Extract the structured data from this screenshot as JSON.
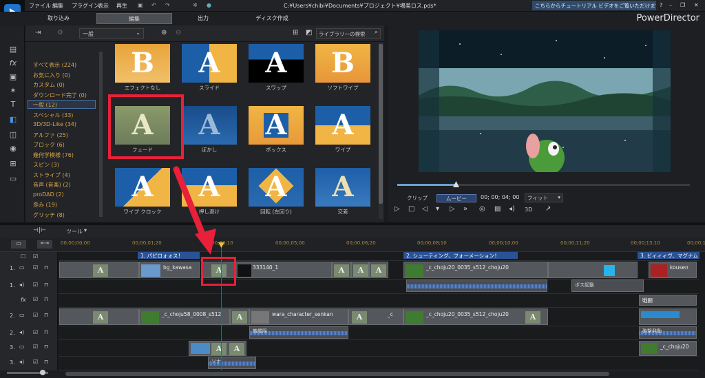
{
  "menu": [
    "ファイル",
    "編集",
    "プラグイン",
    "表示",
    "再生"
  ],
  "window_title": "C:¥Users¥chibi¥Documents¥プロジェクト¥場美ロス.pds*",
  "hint": "こちらからチュートリアル ビデオをご覧いただけます。",
  "app_name": "PowerDirector",
  "top_tabs": [
    "取り込み",
    "編集",
    "出力",
    "ディスク作成"
  ],
  "library": {
    "dropdown": "一般",
    "search_placeholder": "ライブラリーの検索",
    "categories": [
      "すべて表示 (224)",
      "お気に入り (0)",
      "カスタム (0)",
      "ダウンロード完了 (0)",
      "一般 (12)",
      "スペシャル (33)",
      "3D/3D-Like (34)",
      "アルファ (25)",
      "ブロック (6)",
      "幾何学模様 (76)",
      "スピン (3)",
      "ストライプ (4)",
      "音声 (音楽) (2)",
      "proDAD (2)",
      "歪み (19)",
      "グリッチ (8)"
    ],
    "selected_category": "一般 (12)",
    "transitions": [
      "エフェクトなし",
      "スライド",
      "スワップ",
      "ソフトワイプ",
      "フェード",
      "ぼかし",
      "ボックス",
      "ワイプ",
      "ワイプ クロック",
      "押し退け",
      "回転 (左回り)",
      "交差"
    ]
  },
  "preview": {
    "mode_clip": "クリップ",
    "mode_movie": "ムービー",
    "timecode": "00; 00; 04; 00",
    "fit": "フィット",
    "3d": "3D"
  },
  "timeline": {
    "tool_label": "ツール",
    "ruler": [
      "00;00;00;00",
      "00;00;01;20",
      "00;00;03;10",
      "00;00;05;00",
      "00;00;06;20",
      "00;00;08;10",
      "00;00;10;00",
      "00;00;11;20",
      "00;00;13;10",
      "00;00;15;0"
    ],
    "tracks": [
      "1.",
      "1.",
      "fx",
      "2.",
      "2.",
      "3.",
      "3."
    ],
    "chapters": [
      "1. パピロォォス！",
      "2. シューティング、フォーメーション！",
      "3. ビィィィヴ、マグナム"
    ],
    "clips": {
      "bg": "bg_kawasa",
      "c333": "333140_1",
      "choju20": "_c_choju20_0035_s512_choju20",
      "kouen": "kousen",
      "choju58": "_c_choju58_0008_s512",
      "wara": "wara_character_senkan",
      "c2": "_c",
      "choju20b": "_c_choju20_0035_s512_choju20",
      "sentou": "戦闘",
      "c_choju": "_c_choju20",
      "a_note": "ボス起動",
      "a_kaite": "敵艦陥",
      "a_hassha": "砲撃発動",
      "a_boss": "ボス起動",
      "a_sound": "ソナ"
    }
  }
}
